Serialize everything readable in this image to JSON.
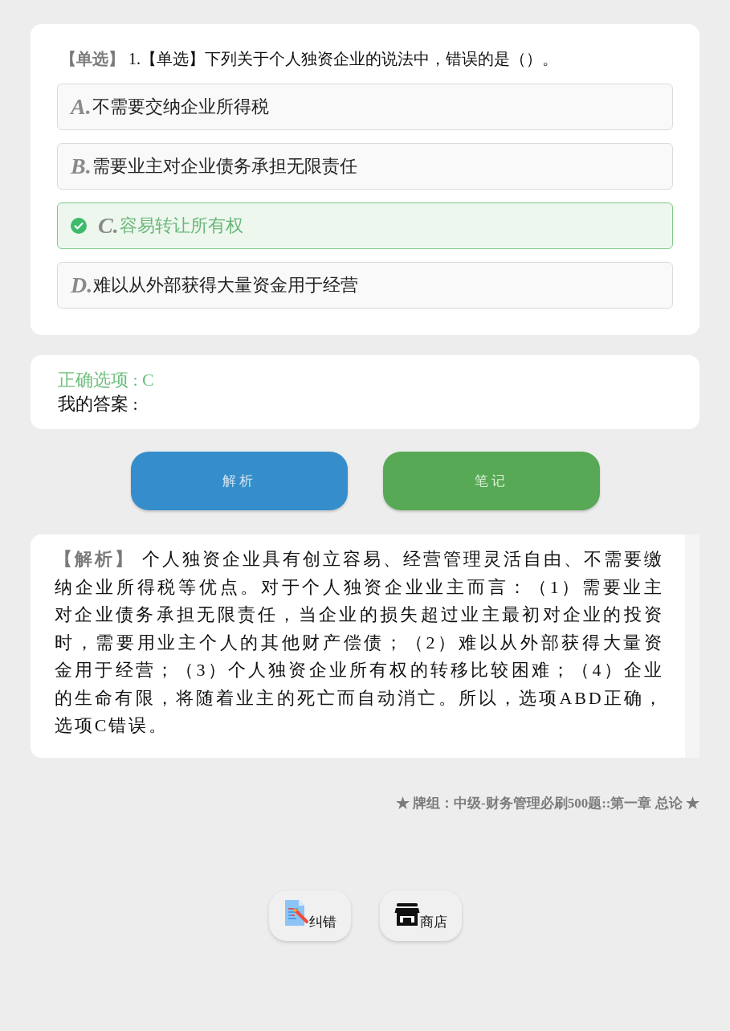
{
  "question": {
    "text": "**【单选】** 1.【单选】下列关于个人独资企业的说法中，错误的是（）。",
    "options": [
      {
        "letter": "A.",
        "text": "不需要交纳企业所得税",
        "correct": false
      },
      {
        "letter": "B.",
        "text": "需要业主对企业债务承担无限责任",
        "correct": false
      },
      {
        "letter": "C.",
        "text": "容易转让所有权",
        "correct": true
      },
      {
        "letter": "D.",
        "text": "难以从外部获得大量资金用于经营",
        "correct": false
      }
    ]
  },
  "answer": {
    "correct_answer": "正确选项 : C",
    "my_answer": "我的答案 :"
  },
  "buttons": [
    {
      "label": "解析",
      "kind": "analysis"
    },
    {
      "label": "笔记",
      "kind": "notes"
    }
  ],
  "analysis": {
    "text": "**【解析】** 个人独资企业具有创立容易、经营管理灵活自由、不需要缴纳企业所得税等优点。对于个人独资企业业主而言：（1）需要业主对企业债务承担无限责任，当企业的损失超过业主最初对企业的投资时，需要用业主个人的其他财产偿债；（2）难以从外部获得大量资金用于经营；（3）个人独资企业所有权的转移比较困难；（4）企业的生命有限，将随着业主的死亡而自动消亡。所以，选项ABD正确，选项C错误。"
  },
  "deck": "★ 牌组：中级-财务管理必刷500题::第一章 总论 ★",
  "toolbar": [
    {
      "label": "纠错",
      "kind": "report"
    },
    {
      "label": "商店",
      "kind": "store"
    }
  ]
}
